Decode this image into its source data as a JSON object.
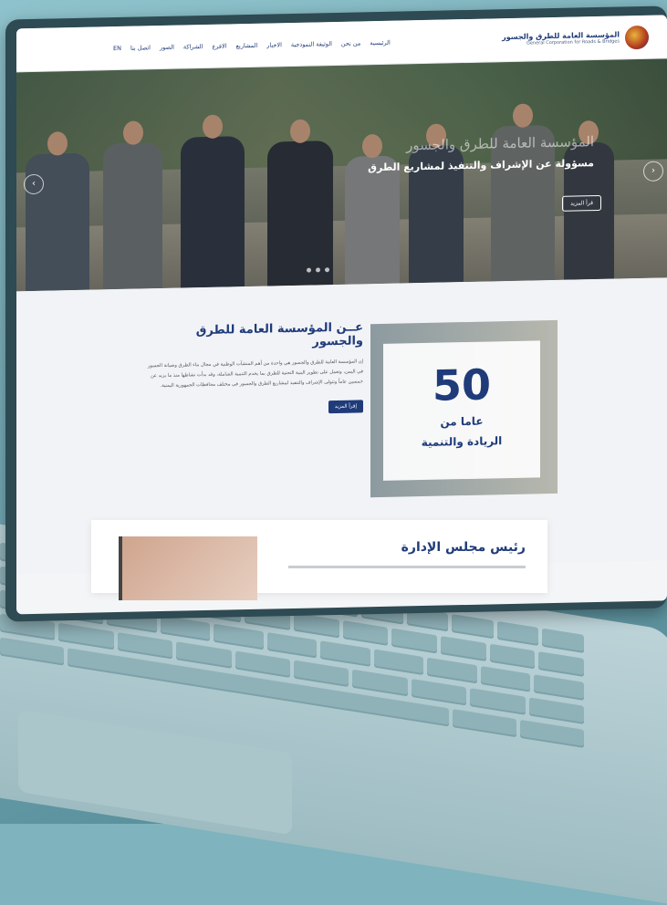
{
  "site": {
    "logo_ar": "المؤسسة العامة للطرق والجسور",
    "logo_en": "General Corporation for Roads & Bridges"
  },
  "nav": {
    "items": [
      "الرئيسية",
      "من نحن",
      "الوثيقة النموذجية",
      "الاخبار",
      "المشاريع",
      "الافرع",
      "الشراكة",
      "الصور",
      "اتصل بنا",
      "EN"
    ]
  },
  "hero": {
    "subtitle": "المؤسسة العامة للطرق والجسور",
    "title": "مسؤولة عن الإشراف والتنفيذ لمشاريع الطرق",
    "button": "قرأ المزيد"
  },
  "about": {
    "title": "عــن المؤسسة العامة للطرق والجسور",
    "body": "إن المؤسسة العامة للطرق والجسور هي واحدة من أهم المنشآت الوطنية في مجال بناء الطرق وصيانة الجسور في اليمن، وتعمل على تطوير البنية التحتية للطرق بما يخدم التنمية الشاملة، وقد بدأت نشاطها منذ ما يزيد عن خمسين عاماً وتتولى الإشراف والتنفيذ لمشاريع الطرق والجسور في مختلف محافظات الجمهورية اليمنية.",
    "button": "إقرأ المزيد",
    "stat_number": "50",
    "stat_line1": "عاما من",
    "stat_line2": "الريادة والتنمية"
  },
  "board": {
    "title": "رئيس مجلس الإدارة"
  }
}
